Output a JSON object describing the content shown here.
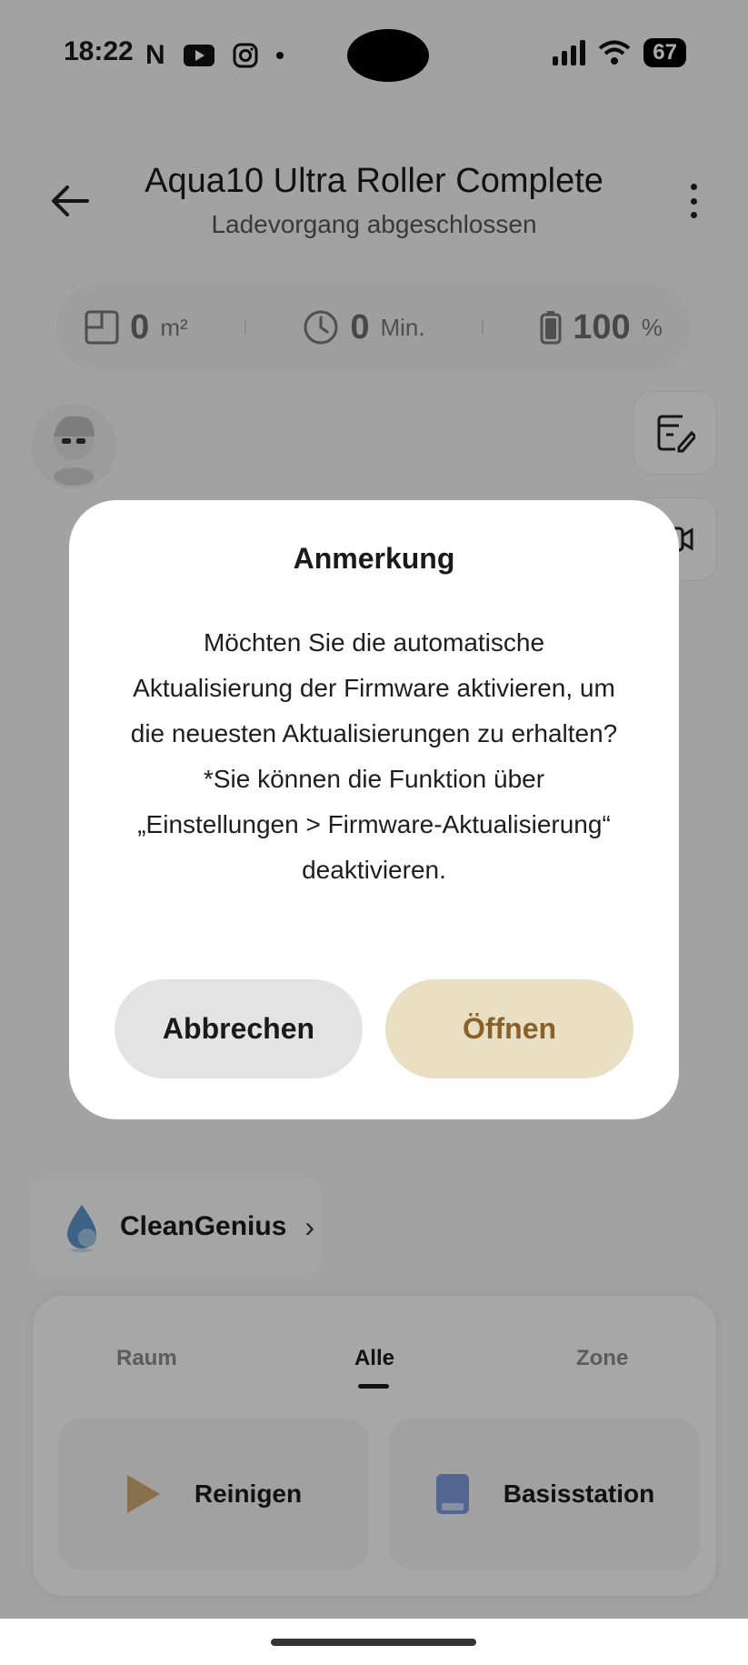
{
  "status_bar": {
    "time": "18:22",
    "battery": "67"
  },
  "header": {
    "title": "Aqua10 Ultra Roller Complete",
    "subtitle": "Ladevorgang abgeschlossen"
  },
  "stats": [
    {
      "value": "0",
      "unit": "m²",
      "icon": "area-icon"
    },
    {
      "value": "0",
      "unit": "Min.",
      "icon": "clock-icon"
    },
    {
      "value": "100",
      "unit": "%",
      "icon": "battery-icon"
    }
  ],
  "clean_genius": {
    "label": "CleanGenius"
  },
  "tabs": [
    "Raum",
    "Alle",
    "Zone"
  ],
  "active_tab": "Alle",
  "actions": {
    "clean": "Reinigen",
    "base_station": "Basisstation"
  },
  "dialog": {
    "title": "Anmerkung",
    "body_lines": [
      "Möchten Sie die automatische",
      "Aktualisierung der Firmware aktivieren, um",
      "die neuesten Aktualisierungen zu erhalten?",
      "*Sie können die Funktion über",
      "„Einstellungen > Firmware-Aktualisierung“",
      "deaktivieren."
    ],
    "cancel_label": "Abbrechen",
    "open_label": "Öffnen"
  },
  "colors": {
    "accent_button_bg": "#e9dfc3",
    "accent_button_text": "#8a5f28"
  }
}
